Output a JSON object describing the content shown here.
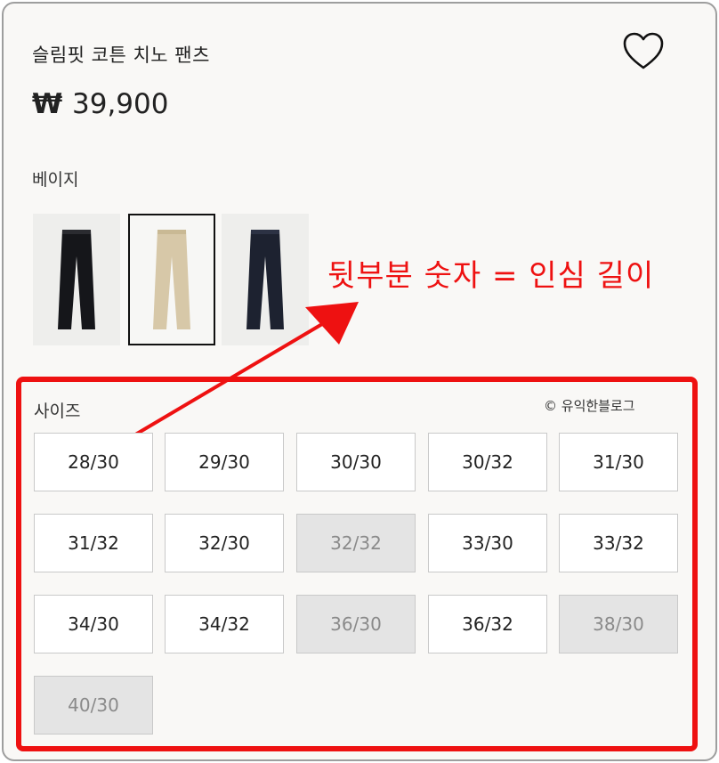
{
  "product": {
    "title": "슬림핏 코튼 치노 팬츠",
    "currency_symbol": "₩",
    "price": "39,900"
  },
  "colors": {
    "selected_label": "베이지",
    "swatches": [
      {
        "name": "블랙",
        "color": "#15161a",
        "selected": false
      },
      {
        "name": "베이지",
        "color": "#d7c8a8",
        "selected": true
      },
      {
        "name": "네이비",
        "color": "#1d2230",
        "selected": false
      }
    ]
  },
  "annotation": {
    "text": "뒷부분 숫자 = 인심 길이",
    "color": "#ee1111"
  },
  "sizes": {
    "label": "사이즈",
    "watermark": "© 유익한블로그",
    "options": [
      {
        "label": "28/30",
        "available": true
      },
      {
        "label": "29/30",
        "available": true
      },
      {
        "label": "30/30",
        "available": true
      },
      {
        "label": "30/32",
        "available": true
      },
      {
        "label": "31/30",
        "available": true
      },
      {
        "label": "31/32",
        "available": true
      },
      {
        "label": "32/30",
        "available": true
      },
      {
        "label": "32/32",
        "available": false
      },
      {
        "label": "33/30",
        "available": true
      },
      {
        "label": "33/32",
        "available": true
      },
      {
        "label": "34/30",
        "available": true
      },
      {
        "label": "34/32",
        "available": true
      },
      {
        "label": "36/30",
        "available": false
      },
      {
        "label": "36/32",
        "available": true
      },
      {
        "label": "38/30",
        "available": false
      },
      {
        "label": "40/30",
        "available": false
      }
    ]
  },
  "icons": {
    "wishlist": "heart-outline-icon"
  }
}
